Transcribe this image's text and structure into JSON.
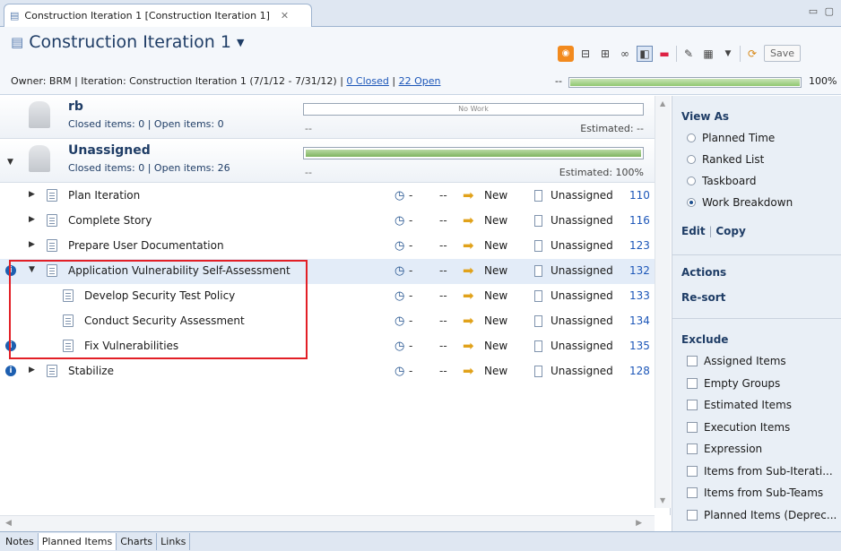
{
  "editor_tab": {
    "label": "Construction Iteration 1 [Construction Iteration 1]"
  },
  "header": {
    "title": "Construction Iteration 1",
    "owner_line": "Owner: BRM | Iteration: Construction Iteration 1 (7/1/12 - 7/31/12) |",
    "closed_link": "0 Closed",
    "separator": "|",
    "open_link": "22 Open",
    "progress_dash": "--",
    "progress_percent": "100%",
    "progress_value": 1.0,
    "save_label": "Save",
    "toolbar_icons": [
      "feed-icon",
      "collapse-all-icon",
      "expand-all-icon",
      "link-icon",
      "split-view-icon",
      "color-icon",
      "edit-icon",
      "new-item-icon",
      "dropdown-icon",
      "refresh-icon"
    ]
  },
  "groups": [
    {
      "name": "rb",
      "summary": "Closed items: 0 | Open items: 0",
      "bar_text": "No Work",
      "bar_value": 0,
      "dash": "--",
      "estimated": "Estimated: --"
    },
    {
      "name": "Unassigned",
      "summary": "Closed items: 0 | Open items: 26",
      "bar_text": "",
      "bar_value": 1.0,
      "dash": "--",
      "estimated": "Estimated: 100%"
    }
  ],
  "rows": [
    {
      "title": "Plan Iteration",
      "clock": "-",
      "dash": "--",
      "status": "New",
      "owner": "Unassigned",
      "id": "110",
      "level": 0,
      "expander": "collapsed",
      "info": false,
      "selected": false
    },
    {
      "title": "Complete Story",
      "clock": "-",
      "dash": "--",
      "status": "New",
      "owner": "Unassigned",
      "id": "116",
      "level": 0,
      "expander": "collapsed",
      "info": false,
      "selected": false
    },
    {
      "title": "Prepare User Documentation",
      "clock": "-",
      "dash": "--",
      "status": "New",
      "owner": "Unassigned",
      "id": "123",
      "level": 0,
      "expander": "collapsed",
      "info": false,
      "selected": false
    },
    {
      "title": "Application Vulnerability Self-Assessment",
      "clock": "-",
      "dash": "--",
      "status": "New",
      "owner": "Unassigned",
      "id": "132",
      "level": 0,
      "expander": "expanded",
      "info": true,
      "selected": true
    },
    {
      "title": "Develop Security Test Policy",
      "clock": "-",
      "dash": "--",
      "status": "New",
      "owner": "Unassigned",
      "id": "133",
      "level": 1,
      "expander": "none",
      "info": false,
      "selected": false
    },
    {
      "title": "Conduct Security Assessment",
      "clock": "-",
      "dash": "--",
      "status": "New",
      "owner": "Unassigned",
      "id": "134",
      "level": 1,
      "expander": "none",
      "info": false,
      "selected": false
    },
    {
      "title": "Fix Vulnerabilities",
      "clock": "-",
      "dash": "--",
      "status": "New",
      "owner": "Unassigned",
      "id": "135",
      "level": 1,
      "expander": "none",
      "info": true,
      "selected": false
    },
    {
      "title": "Stabilize",
      "clock": "-",
      "dash": "--",
      "status": "New",
      "owner": "Unassigned",
      "id": "128",
      "level": 0,
      "expander": "collapsed",
      "info": true,
      "selected": false
    }
  ],
  "right_panel": {
    "view_as": {
      "heading": "View As",
      "options": [
        {
          "label": "Planned Time",
          "selected": false
        },
        {
          "label": "Ranked List",
          "selected": false
        },
        {
          "label": "Taskboard",
          "selected": false
        },
        {
          "label": "Work Breakdown",
          "selected": true
        }
      ],
      "edit_label": "Edit",
      "link_separator": "|",
      "copy_label": "Copy"
    },
    "actions": {
      "heading": "Actions",
      "resort_label": "Re-sort"
    },
    "exclude": {
      "heading": "Exclude",
      "options": [
        "Assigned Items",
        "Empty Groups",
        "Estimated Items",
        "Execution Items",
        "Expression",
        "Items from Sub-Iterati...",
        "Items from Sub-Teams",
        "Planned Items (Deprec..."
      ]
    }
  },
  "bottom_tabs": [
    {
      "label": "Notes",
      "active": false
    },
    {
      "label": "Planned Items",
      "active": true
    },
    {
      "label": "Charts",
      "active": false
    },
    {
      "label": "Links",
      "active": false
    }
  ],
  "colors": {
    "accent": "#1f3d66",
    "link": "#1c56b8",
    "highlight_border": "#e21f26",
    "progress_green": "#8fc770"
  }
}
